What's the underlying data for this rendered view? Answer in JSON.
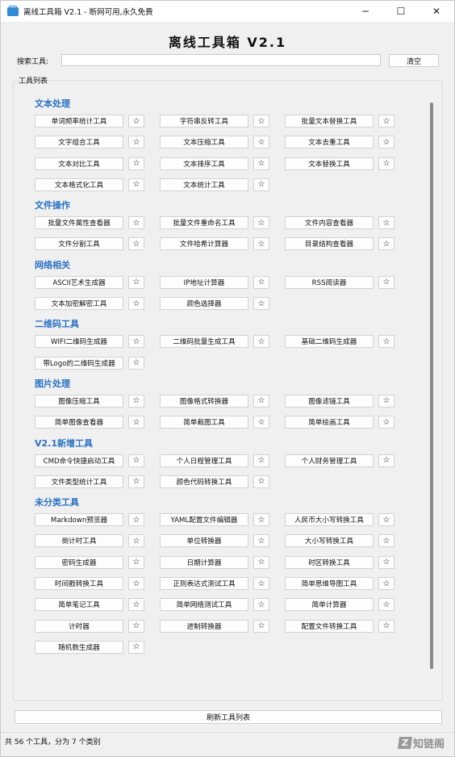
{
  "window": {
    "title": "离线工具箱 V2.1 - 断网可用,永久免费",
    "controls": [
      "─",
      "☐",
      "✕"
    ]
  },
  "heading": "离线工具箱 V2.1",
  "search": {
    "label": "搜索工具:",
    "value": "",
    "placeholder": "",
    "clear_label": "清空"
  },
  "tool_list_label": "工具列表",
  "star_glyph": "☆",
  "categories": [
    {
      "name": "文本处理",
      "rows": [
        [
          "单词频率统计工具",
          "字符串反转工具",
          "批量文本替换工具"
        ],
        [
          "文字组合工具",
          "文本压缩工具",
          "文本去重工具"
        ],
        [
          "文本对比工具",
          "文本排序工具",
          "文本替换工具"
        ],
        [
          "文本格式化工具",
          "文本统计工具"
        ]
      ]
    },
    {
      "name": "文件操作",
      "rows": [
        [
          "批量文件属性查看器",
          "批量文件重命名工具",
          "文件内容查看器"
        ],
        [
          "文件分割工具",
          "文件哈希计算器",
          "目录结构查看器"
        ]
      ]
    },
    {
      "name": "网络相关",
      "rows": [
        [
          "ASCII艺术生成器",
          "IP地址计算器",
          "RSS阅读器"
        ],
        [
          "文本加密解密工具",
          "颜色选择器"
        ]
      ]
    },
    {
      "name": "二维码工具",
      "rows": [
        [
          "WIFI二维码生成器",
          "二维码批量生成工具",
          "基础二维码生成器"
        ],
        [
          "带Logo的二维码生成器"
        ]
      ]
    },
    {
      "name": "图片处理",
      "rows": [
        [
          "图像压缩工具",
          "图像格式转换器",
          "图像滤镜工具"
        ],
        [
          "简单图像查看器",
          "简单截图工具",
          "简单绘画工具"
        ]
      ]
    },
    {
      "name": "V2.1新增工具",
      "rows": [
        [
          "CMD命令快捷启动工具",
          "个人日程管理工具",
          "个人财务管理工具"
        ],
        [
          "文件类型统计工具",
          "颜色代码转换工具"
        ]
      ]
    },
    {
      "name": "未分类工具",
      "rows": [
        [
          "Markdown预览器",
          "YAML配置文件编辑器",
          "人民币大小写转换工具"
        ],
        [
          "倒计时工具",
          "单位转换器",
          "大小写转换工具"
        ],
        [
          "密码生成器",
          "日期计算器",
          "时区转换工具"
        ],
        [
          "时间戳转换工具",
          "正则表达式测试工具",
          "简单思维导图工具"
        ],
        [
          "简单笔记工具",
          "简单网络测试工具",
          "简单计算器"
        ],
        [
          "计时器",
          "进制转换器",
          "配置文件转换工具"
        ],
        [
          "随机数生成器"
        ]
      ]
    }
  ],
  "refresh_label": "刷新工具列表",
  "status": "共 56 个工具，分为 7 个类别",
  "watermark": {
    "box": "Z",
    "text": "知链阁"
  }
}
